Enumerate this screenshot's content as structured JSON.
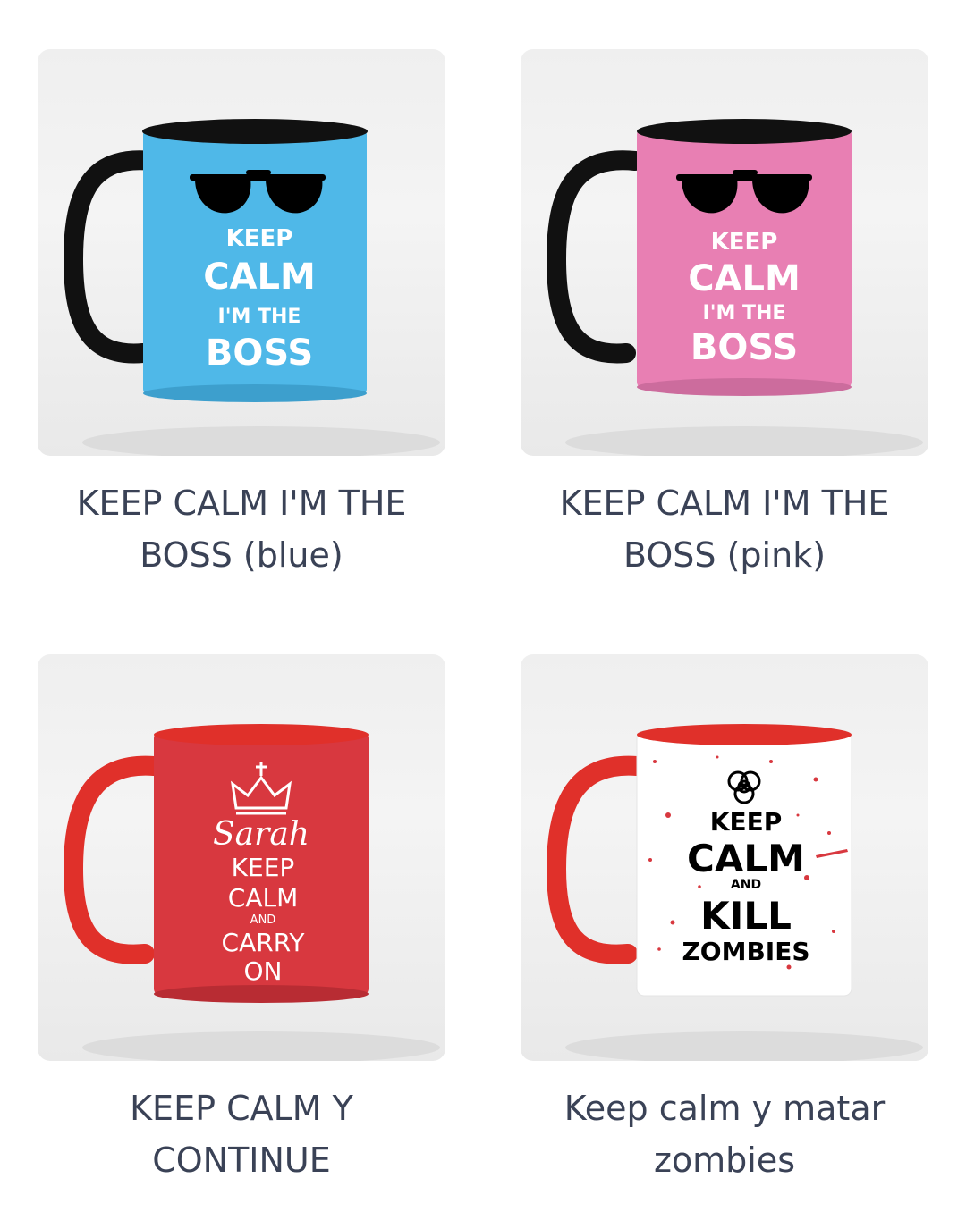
{
  "products": [
    {
      "title": "KEEP CALM I'M THE BOSS (blue)",
      "mug": {
        "body_color": "#4fb8e8",
        "handle_color": "#111111",
        "rim_color": "#111111",
        "print_lines": [
          "KEEP",
          "CALM",
          "I'M THE",
          "BOSS"
        ],
        "icon": "sunglasses-icon"
      }
    },
    {
      "title": "KEEP CALM I'M THE BOSS (pink)",
      "mug": {
        "body_color": "#e87fb3",
        "handle_color": "#111111",
        "rim_color": "#111111",
        "print_lines": [
          "KEEP",
          "CALM",
          "I'M THE",
          "BOSS"
        ],
        "icon": "sunglasses-icon"
      }
    },
    {
      "title": "KEEP CALM Y CONTINUE",
      "mug": {
        "body_color": "#d8383f",
        "handle_color": "#e0302a",
        "rim_color": "#e0302a",
        "print_lines": [
          "Sarah",
          "KEEP",
          "CALM",
          "AND",
          "CARRY",
          "ON"
        ],
        "icon": "crown-icon"
      }
    },
    {
      "title": "Keep calm y matar zombies",
      "mug": {
        "body_color": "#ffffff",
        "handle_color": "#e0302a",
        "rim_color": "#e0302a",
        "print_lines": [
          "KEEP",
          "CALM",
          "AND",
          "KILL",
          "ZOMBIES"
        ],
        "icon": "biohazard-icon"
      }
    }
  ]
}
